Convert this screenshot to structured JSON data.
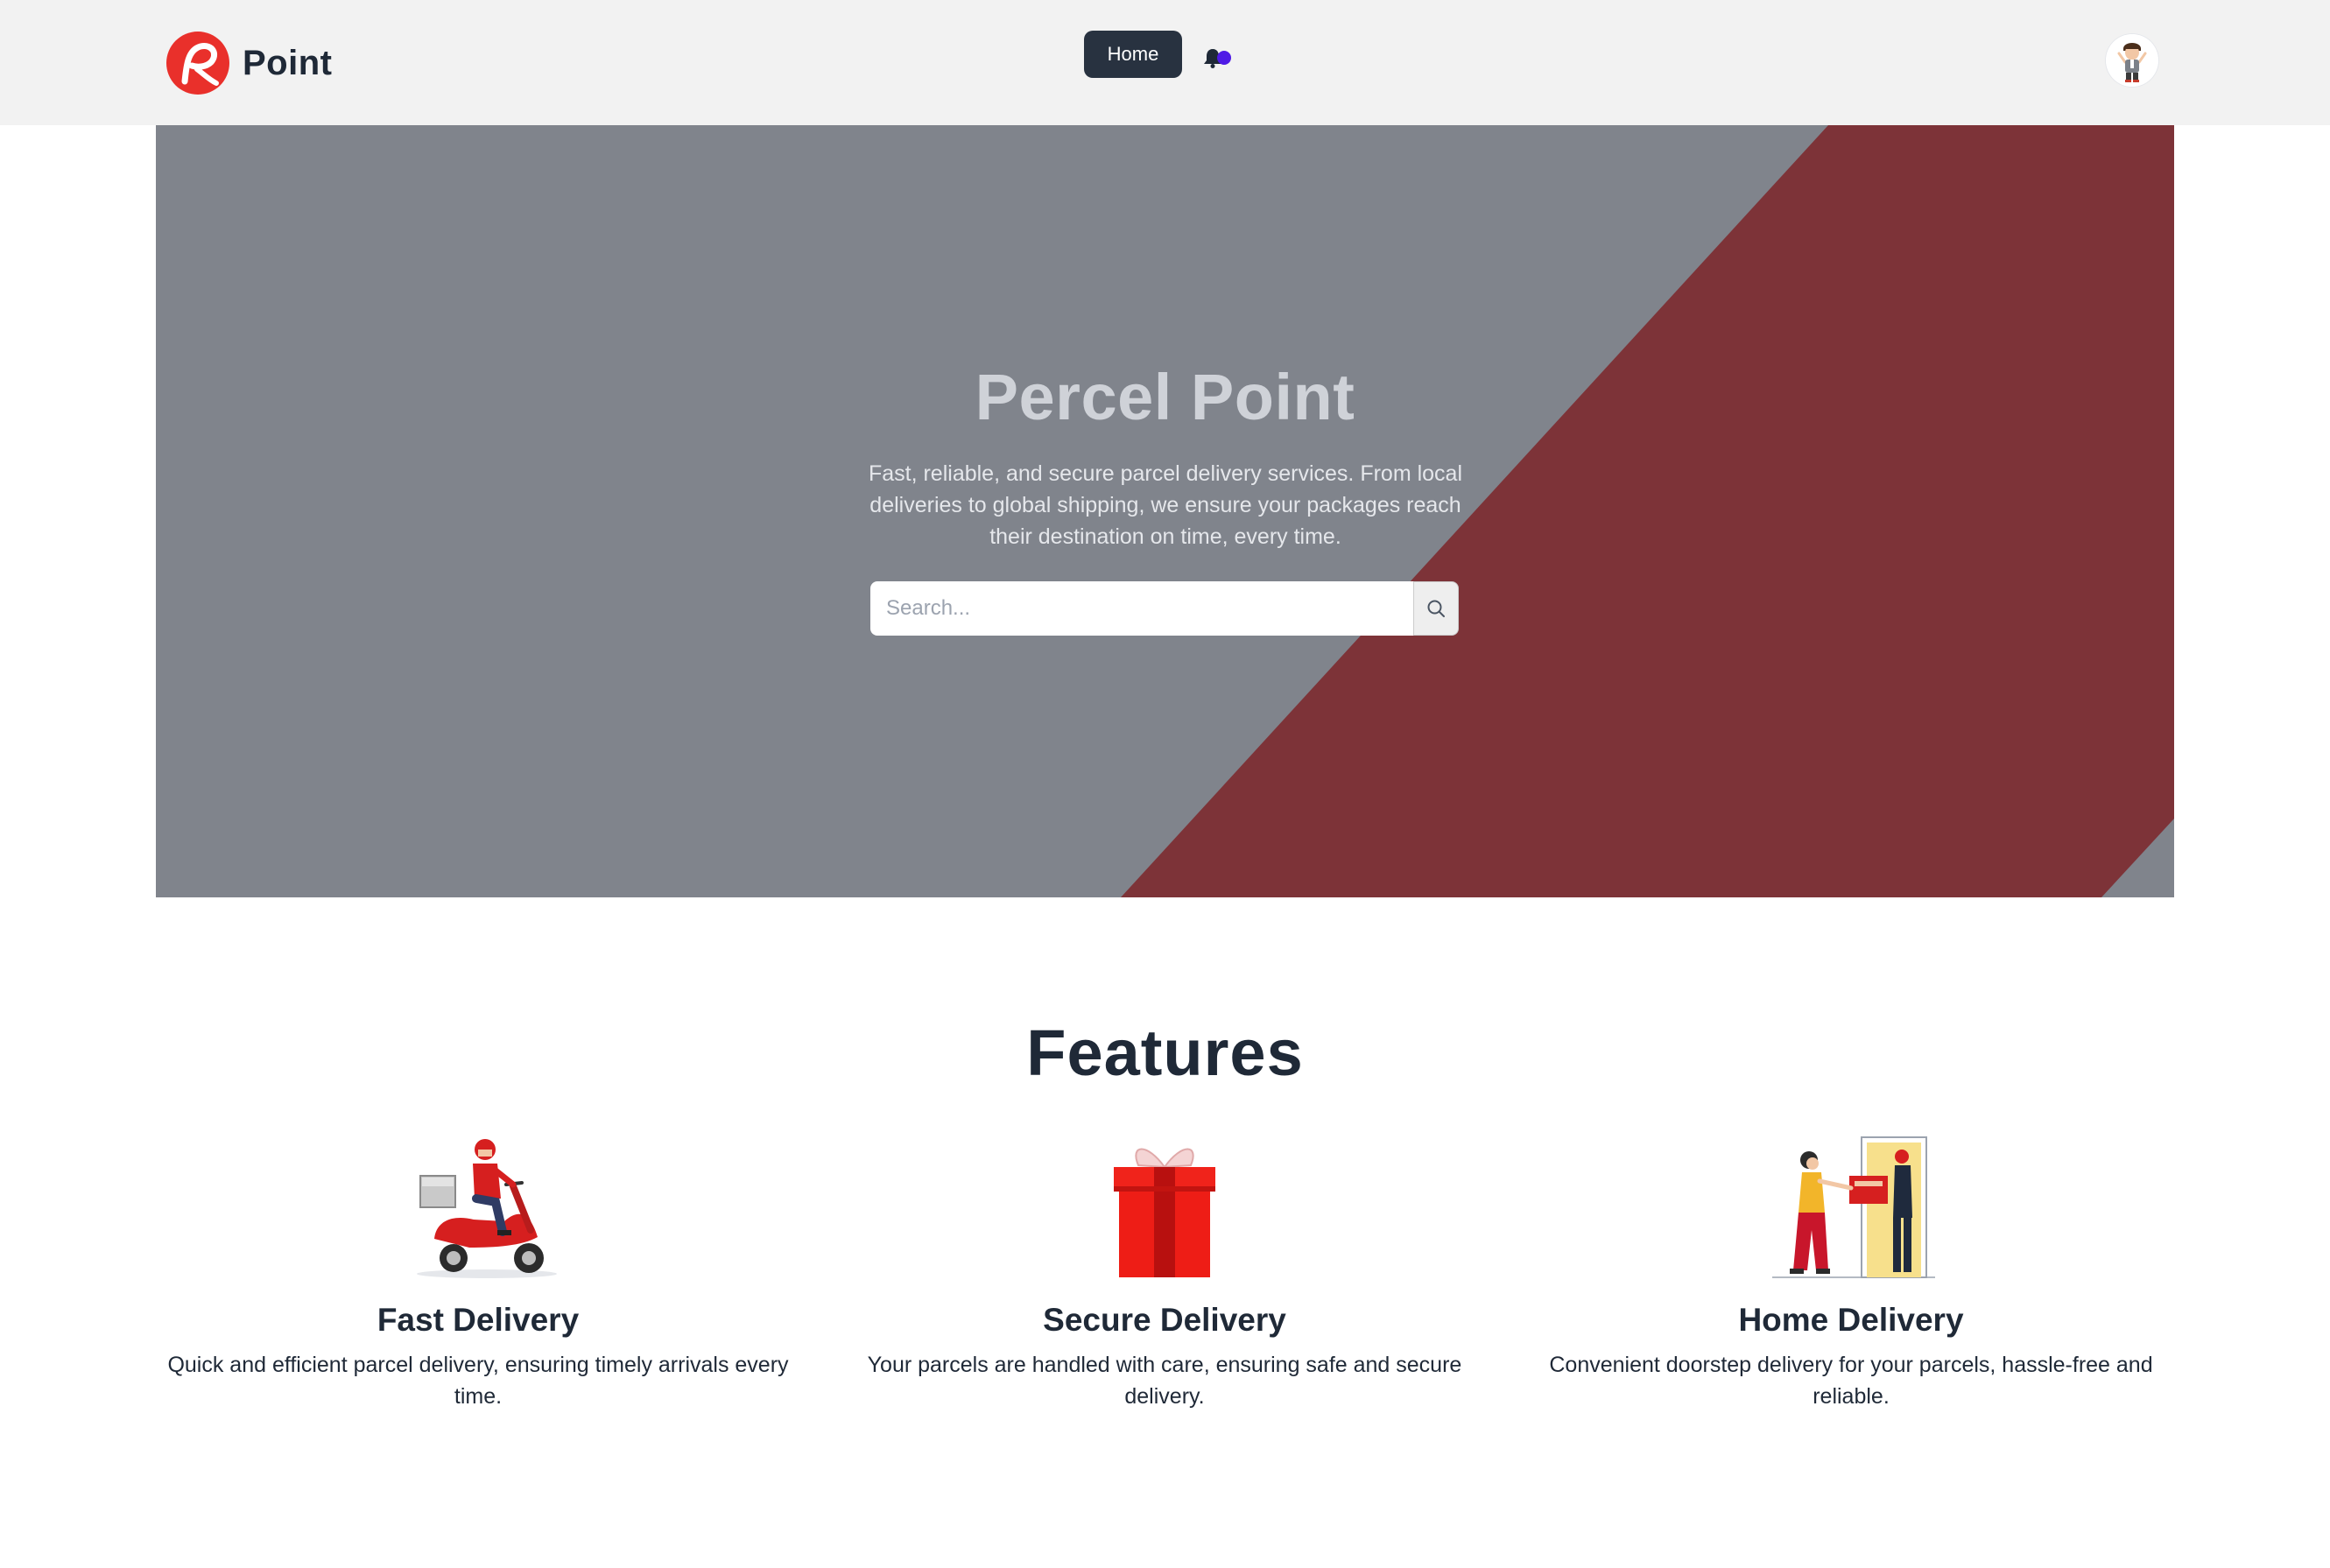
{
  "colors": {
    "brand_red": "#e9302b",
    "nav_bg": "#f2f2f2",
    "home_btn_bg": "#283240",
    "hero_gray": "#80848c",
    "hero_maroon": "#7d3338",
    "bell_dot": "#4f1ae6"
  },
  "navbar": {
    "brand_name": "Point",
    "home_label": "Home",
    "logo_icon": "brand-logo-icon",
    "bell_icon": "bell-icon",
    "avatar_icon": "user-avatar"
  },
  "hero": {
    "title": "Percel Point",
    "description": "Fast, reliable, and secure parcel delivery services. From local deliveries to global shipping, we ensure your packages reach their destination on time, every time.",
    "search_placeholder": "Search...",
    "search_icon": "search-icon"
  },
  "features": {
    "title": "Features",
    "items": [
      {
        "title": "Fast Delivery",
        "description": "Quick and efficient parcel delivery, ensuring timely arrivals every time.",
        "icon": "scooter-rider-icon"
      },
      {
        "title": "Secure Delivery",
        "description": "Your parcels are handled with care, ensuring safe and secure delivery.",
        "icon": "gift-box-icon"
      },
      {
        "title": "Home Delivery",
        "description": "Convenient doorstep delivery for your parcels, hassle-free and reliable.",
        "icon": "doorstep-delivery-icon"
      }
    ]
  }
}
